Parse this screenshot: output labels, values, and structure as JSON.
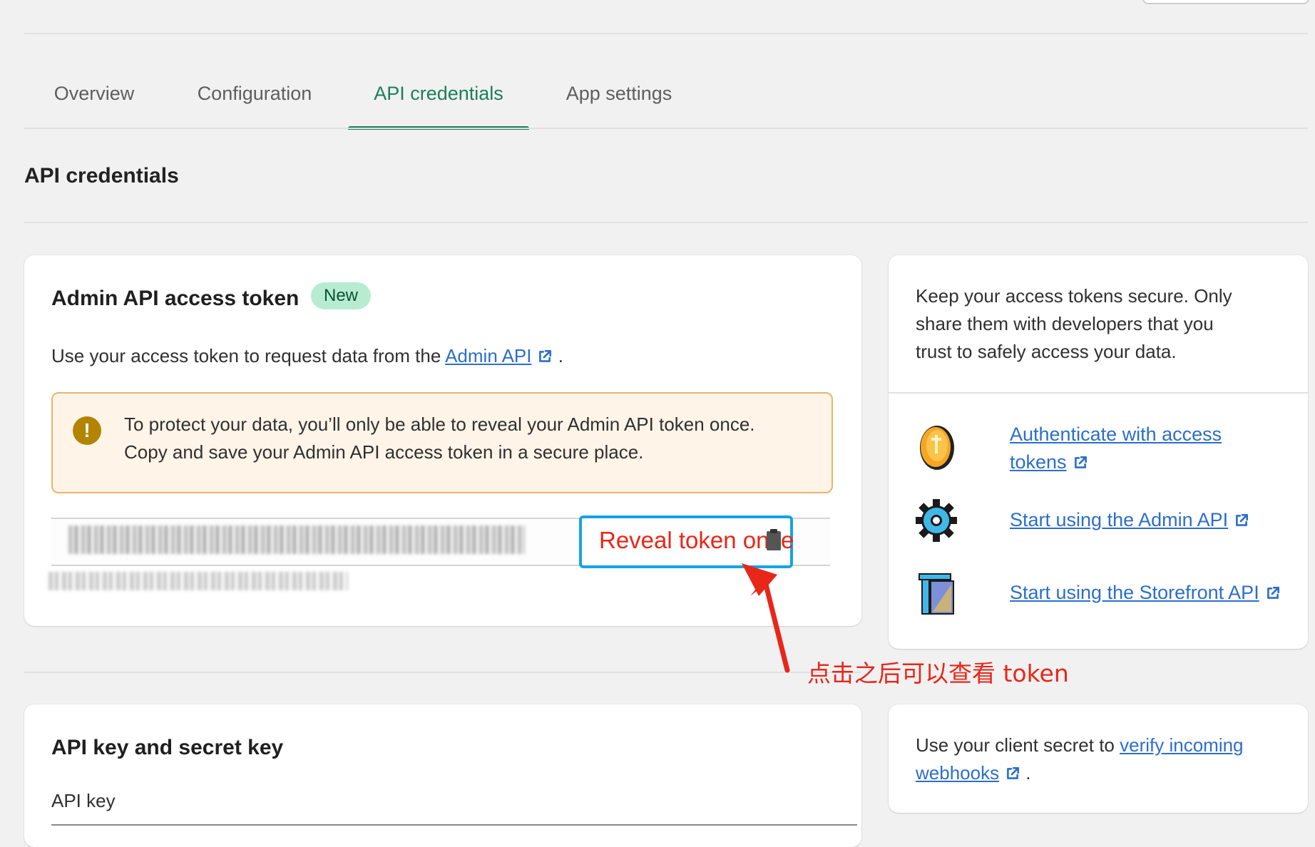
{
  "tabs": [
    {
      "label": "Overview",
      "active": false
    },
    {
      "label": "Configuration",
      "active": false
    },
    {
      "label": "API credentials",
      "active": true
    },
    {
      "label": "App settings",
      "active": false
    }
  ],
  "page": {
    "section_title": "API credentials"
  },
  "admin_token": {
    "title": "Admin API access token",
    "badge": "New",
    "desc_prefix": "Use your access token to request data from the ",
    "desc_link": "Admin API",
    "desc_suffix": " .",
    "banner_line1": "To protect your data, you’ll only be able to reveal your Admin API token once.",
    "banner_line2": "Copy and save your Admin API access token in a secure place.",
    "reveal_button": "Reveal token once"
  },
  "security_tip": {
    "line1": "Keep your access tokens secure. Only",
    "line2": "share them with developers that you",
    "line3": "trust to safely access your data."
  },
  "resources": [
    {
      "icon": "coin-icon",
      "line1": "Authenticate with access",
      "line2": "tokens"
    },
    {
      "icon": "gear-icon",
      "line1": "Start using the Admin API",
      "line2": ""
    },
    {
      "icon": "storefront-icon",
      "line1": "Start using the Storefront API",
      "line2": ""
    }
  ],
  "api_keys": {
    "title": "API key and secret key",
    "api_key_label": "API key"
  },
  "webhook_tip": {
    "prefix": "Use your client secret to ",
    "link1": "verify incoming",
    "link2": "webhooks",
    "suffix": " ."
  },
  "annotation": {
    "text": "点击之后可以查看 token"
  },
  "colors": {
    "accent": "#1a7f5a",
    "link": "#2c6ecb",
    "badge_bg": "#b7ecd0",
    "banner_bg": "#fff4e8",
    "banner_border": "#e9b66a",
    "annotation_red": "#e8261a",
    "highlight_blue": "#14a3e8"
  }
}
